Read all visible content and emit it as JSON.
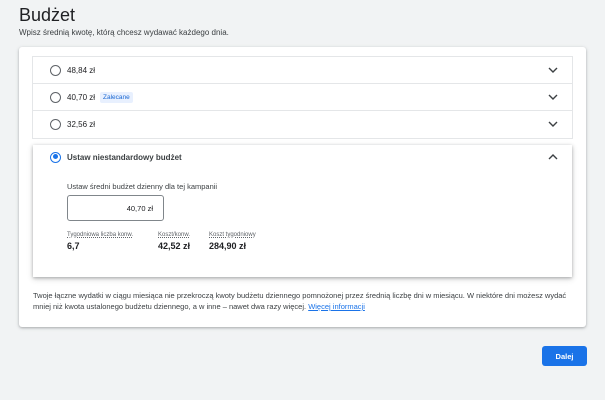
{
  "header": {
    "title": "Budżet",
    "subtitle": "Wpisz średnią kwotę, którą chcesz wydawać każdego dnia."
  },
  "options": [
    {
      "label": "48,84 zł",
      "badge": "",
      "selected": false
    },
    {
      "label": "40,70 zł",
      "badge": "Zalecane",
      "selected": false
    },
    {
      "label": "32,56 zł",
      "badge": "",
      "selected": false
    }
  ],
  "custom": {
    "label": "Ustaw niestandardowy budżet",
    "selected": true,
    "field_label": "Ustaw średni budżet dzienny dla tej kampanii",
    "value": "40,70 zł",
    "stats": [
      {
        "label": "Tygodniowa liczba konw.",
        "value": "6,7"
      },
      {
        "label": "Koszt/konw.",
        "value": "42,52 zł"
      },
      {
        "label": "Koszt tygodniowy",
        "value": "284,90 zł"
      }
    ]
  },
  "footnote": {
    "text": "Twoje łączne wydatki w ciągu miesiąca nie przekroczą kwoty budżetu dziennego pomnożonej przez średnią liczbę dni w miesiącu. W niektóre dni możesz wydać mniej niż kwota ustalonego budżetu dziennego, a w inne – nawet dwa razy więcej.",
    "link": "Więcej informacji"
  },
  "actions": {
    "next_label": "Dalej"
  },
  "colors": {
    "accent": "#1a73e8",
    "badge_bg": "#e8f0fe"
  },
  "icons": {
    "collapsed": "chevron-down-icon",
    "expanded": "chevron-up-icon"
  }
}
